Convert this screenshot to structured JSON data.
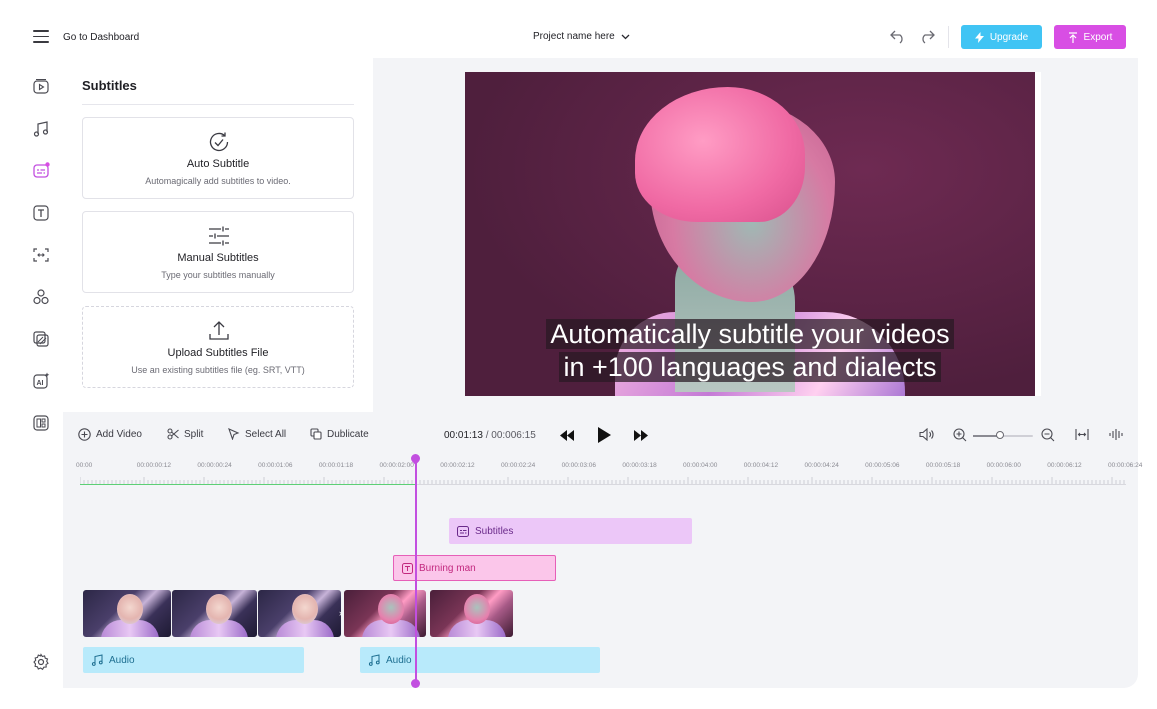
{
  "topbar": {
    "menu_icon": "hamburger-icon",
    "go_to_dashboard": "Go to Dashboard",
    "project_name": "Project name here",
    "upgrade_label": "Upgrade",
    "export_label": "Export",
    "colors": {
      "upgrade": "#40c4f4",
      "export": "#d84ee4"
    }
  },
  "sidebar": {
    "tools": [
      {
        "icon": "video-icon"
      },
      {
        "icon": "music-icon"
      },
      {
        "icon": "subtitles-icon",
        "active": true
      },
      {
        "icon": "text-icon"
      },
      {
        "icon": "transitions-icon"
      },
      {
        "icon": "elements-icon"
      },
      {
        "icon": "overlay-icon"
      },
      {
        "icon": "ai-icon"
      },
      {
        "icon": "templates-icon"
      }
    ],
    "settings_icon": "gear-icon"
  },
  "panel": {
    "title": "Subtitles",
    "cards": [
      {
        "title": "Auto Subtitle",
        "subtitle": "Automagically add subtitles to video.",
        "icon": "auto-subtitle-icon"
      },
      {
        "title": "Manual Subtitles",
        "subtitle": "Type your subtitles manually",
        "icon": "sliders-icon"
      },
      {
        "title": "Upload Subtitles File",
        "subtitle": "Use an existing subtitles file (eg. SRT, VTT)",
        "icon": "upload-icon"
      }
    ]
  },
  "preview": {
    "caption_line1": "Automatically subtitle your videos",
    "caption_line2": "in +100 languages and dialects"
  },
  "toolbar": {
    "add_video": "Add Video",
    "split": "Split",
    "select_all": "Select All",
    "duplicate": "Dublicate",
    "current_time": "00:01:13",
    "separator": "/",
    "duration": "00:006:15",
    "zoom_level": 0.45
  },
  "ruler": {
    "labels": [
      "00:00",
      "00:00:00:12",
      "00:00:00:24",
      "00:00:01:06",
      "00:00:01:18",
      "00:00:02:00",
      "00:00:02:12",
      "00:00:02:24",
      "00:00:03:06",
      "00:00:03:18",
      "00:00:04:00",
      "00:00:04:12",
      "00:00:04:24",
      "00:00:05:06",
      "00:00:05:18",
      "00:00:06:00",
      "00:00:06:12",
      "00:00:06:24"
    ]
  },
  "timeline": {
    "subtitles_clip": "Subtitles",
    "text_clip": "Burning man",
    "audio_clip_1": "Audio",
    "audio_clip_2": "Audio",
    "colors": {
      "playhead": "#c24fe0",
      "progress": "#5ccf75"
    }
  }
}
